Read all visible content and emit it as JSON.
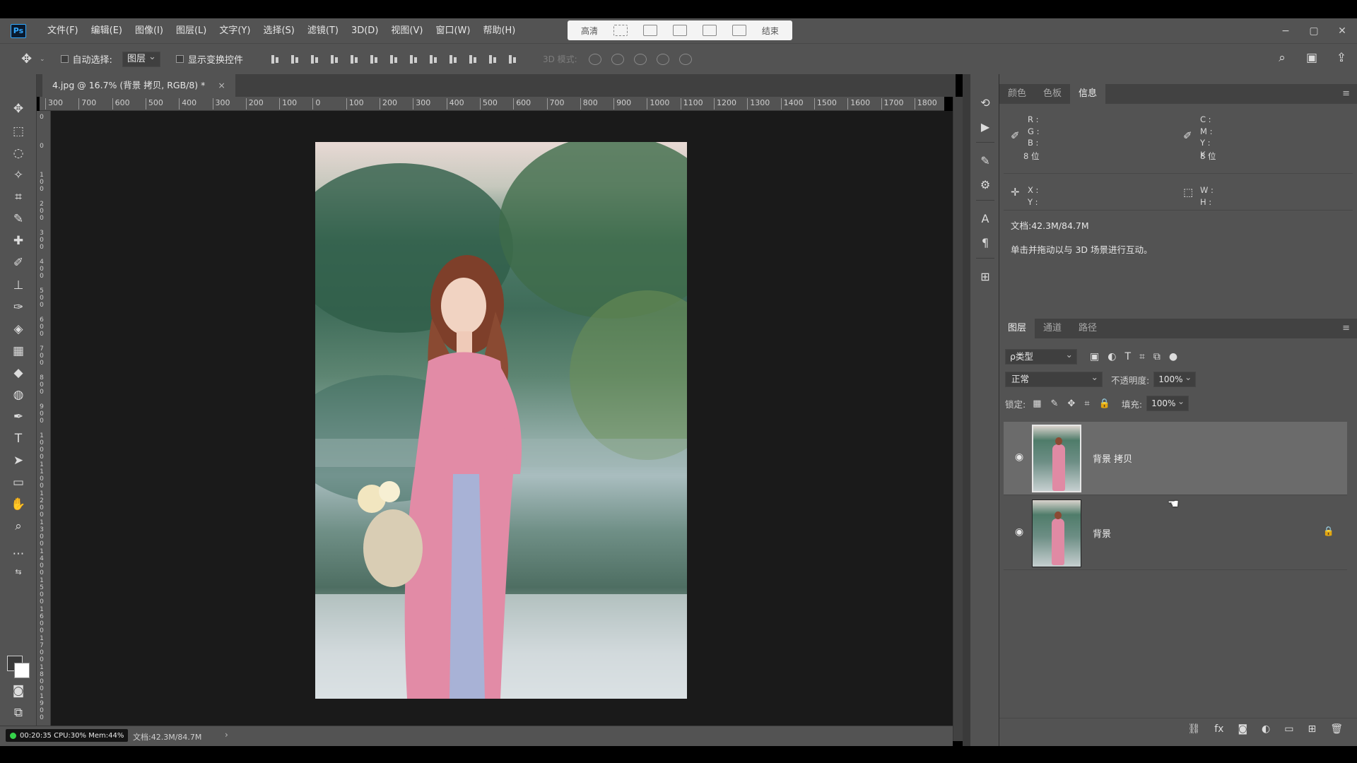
{
  "app": {
    "logo": "Ps"
  },
  "menu": [
    "文件(F)",
    "编辑(E)",
    "图像(I)",
    "图层(L)",
    "文字(Y)",
    "选择(S)",
    "滤镜(T)",
    "3D(D)",
    "视图(V)",
    "窗口(W)",
    "帮助(H)"
  ],
  "capture_bar": {
    "left_label": "高清",
    "right_label": "结束"
  },
  "window_controls": {
    "minimize": "−",
    "restore": "▢",
    "close": "✕"
  },
  "options": {
    "auto_select_label": "自动选择:",
    "auto_select_target": "图层",
    "show_transform_label": "显示变换控件",
    "mode3d_label": "3D 模式:"
  },
  "document": {
    "tab_title": "4.jpg @ 16.7% (背景 拷贝, RGB/8) *",
    "tab_close": "×",
    "ruler_h_ticks": [
      "300",
      "700",
      "600",
      "500",
      "400",
      "300",
      "200",
      "100",
      "0",
      "100",
      "200",
      "300",
      "400",
      "500",
      "600",
      "700",
      "800",
      "900",
      "1000",
      "1100",
      "1200",
      "1300",
      "1400",
      "1500",
      "1600",
      "1700",
      "1800"
    ],
    "ruler_v_ticks": [
      "0",
      "0",
      "1 0 0",
      "2 0 0",
      "3 0 0",
      "4 0 0",
      "5 0 0",
      "6 0 0",
      "7 0 0",
      "8 0 0",
      "9 0 0",
      "1 0 0 0",
      "1 1 0 0",
      "1 2 0 0",
      "1 3 0 0",
      "1 4 0 0",
      "1 5 0 0",
      "1 6 0 0",
      "1 7 0 0",
      "1 8 0 0",
      "1 9 0 0"
    ],
    "status_doc": "文档:42.3M/84.7M",
    "status_arrow": "›"
  },
  "recorder": {
    "text": "00:20:35 CPU:30% Mem:44%"
  },
  "info_panel": {
    "tabs": [
      "颜色",
      "色板",
      "信息"
    ],
    "active_tab": "信息",
    "rgb_labels": "R :\nG :\nB :",
    "cmyk_labels": "C :\nM :\nY :\nK :",
    "bits_left": "8 位",
    "bits_right": "8 位",
    "xy_labels": "X :\nY :",
    "wh_labels": "W :\nH :",
    "doc_size": "文档:42.3M/84.7M",
    "hint": "单击并拖动以与 3D 场景进行互动。"
  },
  "layers_panel": {
    "tabs": [
      "图层",
      "通道",
      "路径"
    ],
    "active_tab": "图层",
    "kind_filter": "ρ类型",
    "blend_mode": "正常",
    "opacity_label": "不透明度:",
    "opacity_value": "100%",
    "lock_label": "锁定:",
    "fill_label": "填充:",
    "fill_value": "100%",
    "layers": [
      {
        "name": "背景 拷贝",
        "selected": true,
        "locked": false
      },
      {
        "name": "背景",
        "selected": false,
        "locked": true
      }
    ]
  },
  "colors": {
    "ui_dark": "#535353",
    "ui_darker": "#424242",
    "canvas_bg": "#1a1a1a",
    "accent": "#31a8ff"
  }
}
